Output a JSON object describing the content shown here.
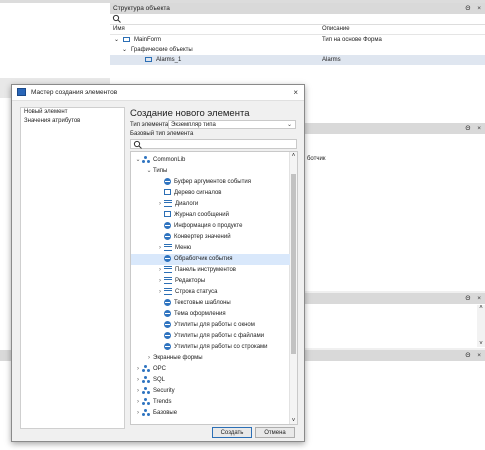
{
  "structure_panel": {
    "title": "Структура объекта",
    "col_name": "Имя",
    "col_desc": "Описание",
    "rows": [
      {
        "name": "MainForm",
        "desc": "Тип на основе Форма"
      },
      {
        "name": "Графические объекты",
        "desc": ""
      },
      {
        "name": "Alarms_1",
        "desc": "Alarms"
      }
    ]
  },
  "right_panel": {
    "partial_text": "ботчик"
  },
  "window_controls": {
    "pin": "Θ",
    "close": "×"
  },
  "dialog": {
    "title": "Мастер создания элементов",
    "close": "×",
    "steps": [
      "Новый элемент",
      "Значения атрибутов"
    ],
    "heading": "Создание нового элемента",
    "type_label": "Тип элемента",
    "type_value": "Экземпляр типа",
    "base_label": "Базовый тип элемента",
    "tree": [
      {
        "label": "CommonLib",
        "level": 0,
        "expand": "v",
        "icon": "module-icon"
      },
      {
        "label": "Типы",
        "level": 1,
        "expand": "v",
        "icon": ""
      },
      {
        "label": "Буфер аргументов события",
        "level": 2,
        "expand": "",
        "icon": "circle-icon"
      },
      {
        "label": "Дерево сигналов",
        "level": 2,
        "expand": "",
        "icon": "square-icon"
      },
      {
        "label": "Диалоги",
        "level": 2,
        "expand": ">",
        "icon": "list-icon"
      },
      {
        "label": "Журнал сообщений",
        "level": 2,
        "expand": "",
        "icon": "square-icon"
      },
      {
        "label": "Информация о продукте",
        "level": 2,
        "expand": "",
        "icon": "circle-icon"
      },
      {
        "label": "Конвертер значений",
        "level": 2,
        "expand": "",
        "icon": "circle-icon"
      },
      {
        "label": "Меню",
        "level": 2,
        "expand": ">",
        "icon": "list-icon"
      },
      {
        "label": "Обработчик события",
        "level": 2,
        "expand": "",
        "icon": "circle-icon",
        "selected": true
      },
      {
        "label": "Панель инструментов",
        "level": 2,
        "expand": ">",
        "icon": "list-icon"
      },
      {
        "label": "Редакторы",
        "level": 2,
        "expand": ">",
        "icon": "list-icon"
      },
      {
        "label": "Строка статуса",
        "level": 2,
        "expand": ">",
        "icon": "list-icon"
      },
      {
        "label": "Текстовые шаблоны",
        "level": 2,
        "expand": "",
        "icon": "circle-icon"
      },
      {
        "label": "Тема оформления",
        "level": 2,
        "expand": "",
        "icon": "circle-icon"
      },
      {
        "label": "Утилиты для работы с окном",
        "level": 2,
        "expand": "",
        "icon": "circle-icon"
      },
      {
        "label": "Утилиты для работы с файлами",
        "level": 2,
        "expand": "",
        "icon": "circle-icon"
      },
      {
        "label": "Утилиты для работы со строками",
        "level": 2,
        "expand": "",
        "icon": "circle-icon"
      },
      {
        "label": "Экранные формы",
        "level": 1,
        "expand": ">",
        "icon": ""
      },
      {
        "label": "OPC",
        "level": 0,
        "expand": ">",
        "icon": "module-icon"
      },
      {
        "label": "SQL",
        "level": 0,
        "expand": ">",
        "icon": "module-icon"
      },
      {
        "label": "Security",
        "level": 0,
        "expand": ">",
        "icon": "module-icon"
      },
      {
        "label": "Trends",
        "level": 0,
        "expand": ">",
        "icon": "module-icon"
      },
      {
        "label": "Базовые",
        "level": 0,
        "expand": ">",
        "icon": "module-icon"
      }
    ],
    "create_button": "Создать",
    "cancel_button": "Отмена"
  }
}
